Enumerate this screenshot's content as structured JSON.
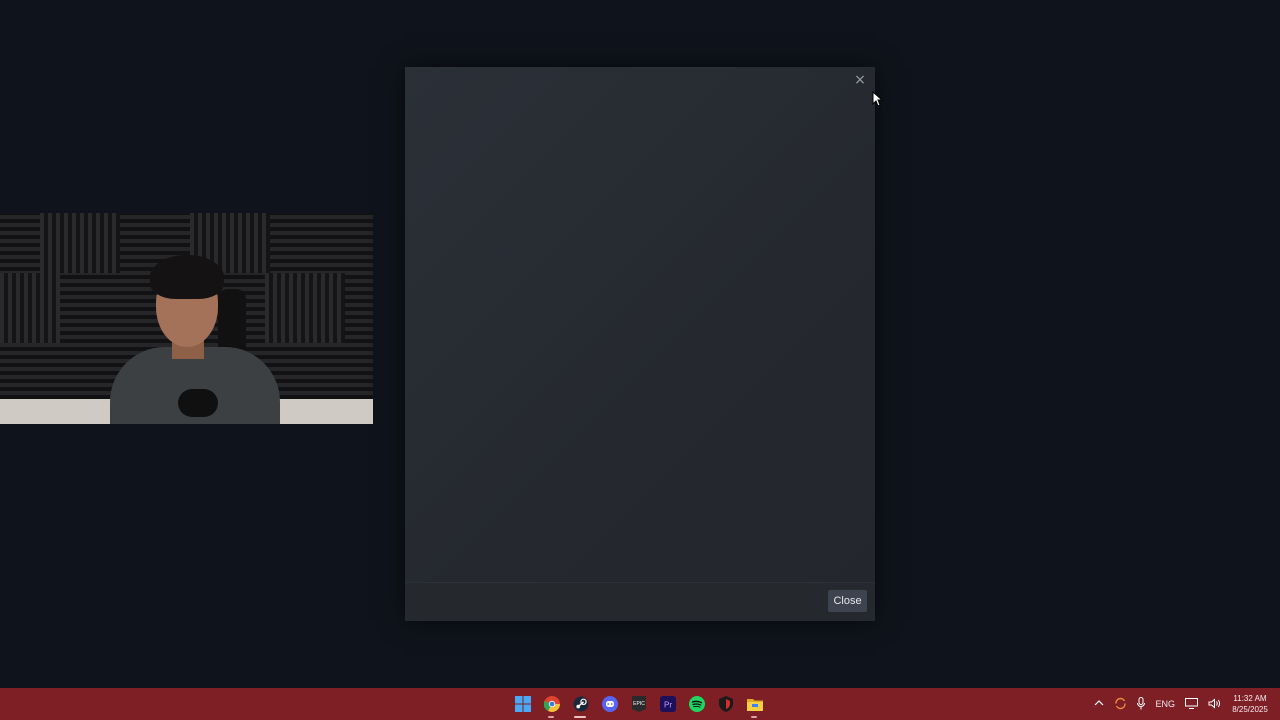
{
  "dialog": {
    "close_x": "×",
    "close_button_label": "Close"
  },
  "taskbar": {
    "apps": [
      {
        "name": "windows-start",
        "color": "#3b9ff0"
      },
      {
        "name": "chrome",
        "color": "#e8b23a"
      },
      {
        "name": "steam",
        "color": "#ffffff"
      },
      {
        "name": "discord",
        "color": "#5865f2"
      },
      {
        "name": "epic-games",
        "color": "#e6e6e6"
      },
      {
        "name": "premiere-pro",
        "color": "#2b1d6b"
      },
      {
        "name": "spotify",
        "color": "#1ed760"
      },
      {
        "name": "shield",
        "color": "#d42b2b"
      },
      {
        "name": "file-explorer",
        "color": "#f2c12e"
      }
    ],
    "tray": {
      "language": "ENG",
      "time": "11:32 AM",
      "date": "8/25/2025"
    }
  },
  "colors": {
    "desktop_bg": "#0f141c",
    "taskbar_bg": "#7e1f26",
    "dialog_bg": "#2b3038",
    "button_bg": "#3d4450"
  }
}
